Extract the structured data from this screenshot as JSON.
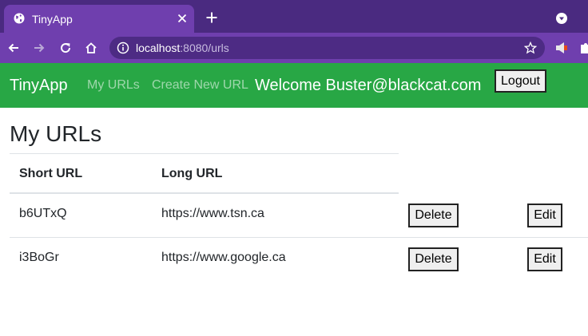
{
  "browser": {
    "tab_title": "TinyApp",
    "url_host": "localhost",
    "url_rest": ":8080/urls"
  },
  "navbar": {
    "brand": "TinyApp",
    "links": [
      "My URLs",
      "Create New URL"
    ],
    "welcome": "Welcome Buster@blackcat.com",
    "logout_label": "Logout"
  },
  "main": {
    "title": "My URLs",
    "headers": {
      "short": "Short URL",
      "long": "Long URL"
    },
    "rows": [
      {
        "short": "b6UTxQ",
        "long": "https://www.tsn.ca",
        "delete_label": "Delete",
        "edit_label": "Edit"
      },
      {
        "short": "i3BoGr",
        "long": "https://www.google.ca",
        "delete_label": "Delete",
        "edit_label": "Edit"
      }
    ]
  },
  "colors": {
    "navbar": "#28a745",
    "chrome_frame": "#4a2a80",
    "chrome_toolbar": "#6f3fae"
  },
  "icons": [
    "globe-icon",
    "close-icon",
    "plus-icon",
    "chevron-down-icon",
    "back-arrow-icon",
    "forward-arrow-icon",
    "reload-icon",
    "home-icon",
    "info-icon",
    "star-icon",
    "extension-icon",
    "puzzle-icon"
  ]
}
